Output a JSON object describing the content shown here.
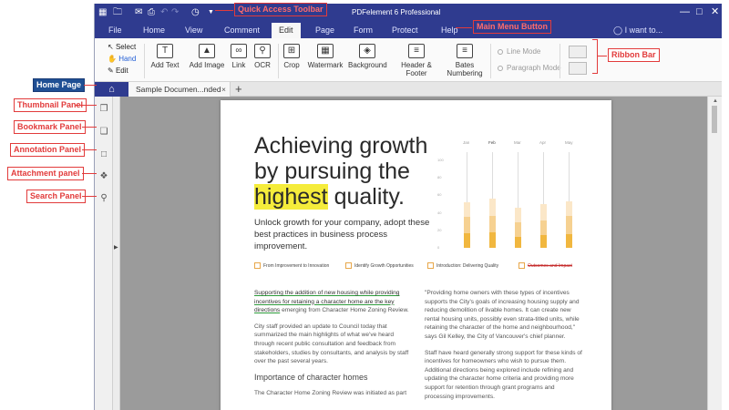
{
  "window": {
    "title": "PDFelement 6 Professional",
    "icons": [
      "logo-icon",
      "folder-icon",
      "mail-icon",
      "print-icon",
      "undo-icon",
      "redo-icon",
      "history-icon",
      "dropdown-icon"
    ]
  },
  "menu": {
    "items": [
      "File",
      "Home",
      "View",
      "Comment",
      "Edit",
      "Page",
      "Form",
      "Protect",
      "Help"
    ],
    "active": "Edit",
    "search_label": "I want to..."
  },
  "ribbon": {
    "select": "Select",
    "hand": "Hand",
    "edit": "Edit",
    "tools": [
      "Add Text",
      "Add Image",
      "Link",
      "OCR",
      "Crop",
      "Watermark",
      "Background",
      "Header & Footer",
      "Bates Numbering"
    ],
    "line_mode": "Line Mode",
    "paragraph_mode": "Paragraph Mode"
  },
  "tabs": {
    "document": "Sample Documen...nded"
  },
  "annotations": {
    "quick_access": "Quick Access Toolbar",
    "main_menu": "Main Menu Button",
    "ribbon_bar": "Ribbon Bar",
    "home_page": "Home Page",
    "thumbnail": "Thumbnail Panel",
    "bookmark": "Bookmark Panel",
    "annotation": "Annotation Panel",
    "attachment": "Attachment panel",
    "search": "Search Panel"
  },
  "document": {
    "headline_1": "Achieving growth",
    "headline_2": "by pursuing the",
    "headline_hl": "highest",
    "headline_3": " quality.",
    "lead": "Unlock growth for your company, adopt these best practices in business process improvement.",
    "bullets": [
      "From Improvement to Innovation",
      "Identify Growth Opportunities",
      "Introduction: Delivering Quality",
      "Outcomes and Impact"
    ],
    "left_p1_underlined": "Supporting the addition of new housing while providing incentives for retaining a character home are the key directions",
    "left_p1_rest": " emerging from Character Home Zoning Review.",
    "left_p2": "City staff provided an update to Council today that summarized the main highlights of what we've heard through recent public consultation and feedback from stakeholders, studies by consultants, and analysis by staff over the past several years.",
    "left_h3": "Importance of character homes",
    "left_p3": "The Character Home Zoning Review was initiated as part",
    "right_p1": "\"Providing home owners with these types of incentives supports the City's goals of increasing housing supply and reducing demolition of livable homes.  It can create new rental housing units, possibly even strata-titled units, while retaining the character of the home and neighbourhood,\" says Gil Kelley, the City of Vancouver's chief planner.",
    "right_p2": "Staff have heard generally strong support for these kinds of incentives for homeowners who wish to pursue them. Additional directions being explored include refining and updating the character home criteria and providing more support for retention through grant programs and processing improvements."
  },
  "chart_data": {
    "type": "bar",
    "categories": [
      "Jan",
      "Feb",
      "Mar",
      "Apr",
      "May"
    ],
    "y_ticks": [
      "100",
      "80",
      "60",
      "40",
      "20",
      "0"
    ],
    "ylim": [
      0,
      100
    ],
    "series": [
      {
        "values": [
          17,
          18,
          13,
          15,
          16
        ]
      },
      {
        "values": [
          18,
          18,
          16,
          16,
          20
        ]
      },
      {
        "values": [
          17,
          20,
          17,
          19,
          17
        ]
      }
    ],
    "colors": [
      "#f1b73f",
      "#f6d191",
      "#fbe7c8"
    ],
    "active_category": "Feb"
  }
}
